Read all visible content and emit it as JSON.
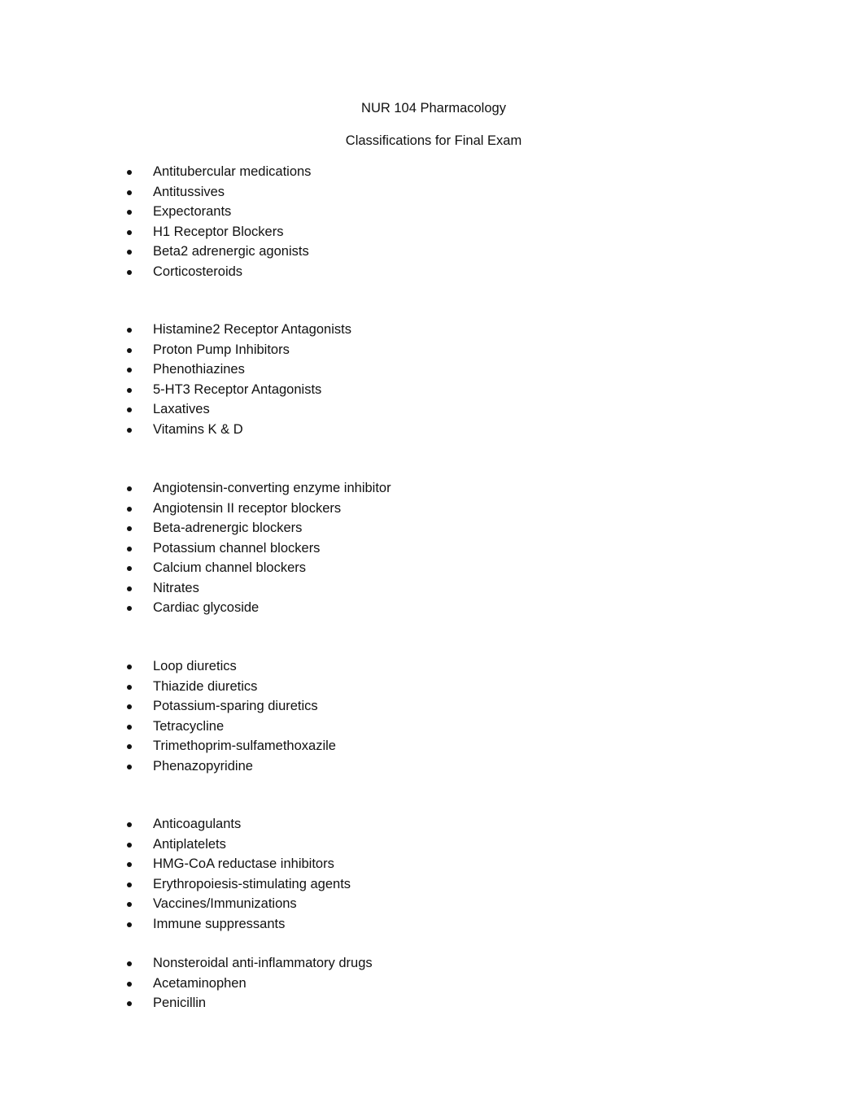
{
  "document": {
    "title": "NUR 104 Pharmacology",
    "subtitle": "Classifications for Final Exam"
  },
  "groups": [
    {
      "items": [
        "Antitubercular medications",
        "Antitussives",
        "Expectorants",
        "H1 Receptor Blockers",
        "Beta2 adrenergic agonists",
        "Corticosteroids"
      ]
    },
    {
      "items": [
        "Histamine2 Receptor Antagonists",
        "Proton Pump Inhibitors",
        "Phenothiazines",
        "5-HT3 Receptor Antagonists",
        "Laxatives",
        "Vitamins K & D"
      ]
    },
    {
      "items": [
        "Angiotensin-converting enzyme inhibitor",
        "Angiotensin II receptor blockers",
        "Beta-adrenergic blockers",
        "Potassium channel blockers",
        "Calcium channel blockers",
        "Nitrates",
        "Cardiac glycoside"
      ]
    },
    {
      "items": [
        "Loop diuretics",
        "Thiazide diuretics",
        "Potassium-sparing diuretics",
        "Tetracycline",
        "Trimethoprim-sulfamethoxazile",
        "Phenazopyridine"
      ]
    },
    {
      "items": [
        "Anticoagulants",
        "Antiplatelets",
        "HMG-CoA reductase inhibitors",
        "Erythropoiesis-stimulating agents",
        "Vaccines/Immunizations",
        "Immune suppressants"
      ]
    },
    {
      "items": [
        "Nonsteroidal anti-inflammatory drugs",
        "Acetaminophen",
        "Penicillin"
      ]
    }
  ],
  "bullet_icon": "filled-circle-bullet"
}
